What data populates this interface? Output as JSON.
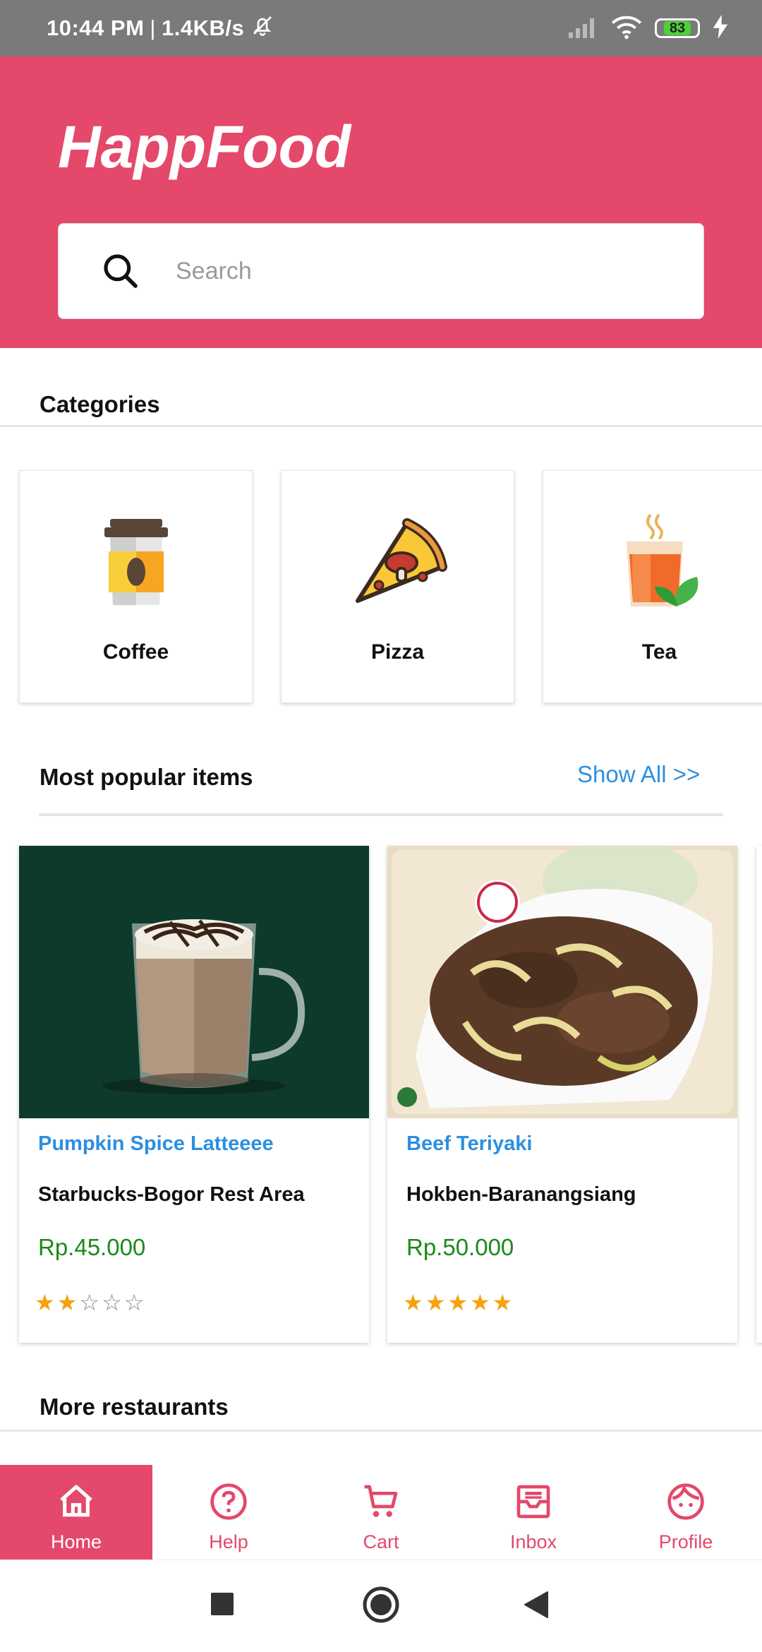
{
  "status_bar": {
    "time": "10:44 PM",
    "separator": "|",
    "speed": "1.4KB/s",
    "battery": "83"
  },
  "header": {
    "app_title": "HappFood",
    "search_placeholder": "Search",
    "background_color": "#e4486a"
  },
  "categories": {
    "title": "Categories",
    "items": [
      {
        "label": "Coffee",
        "icon": "coffee-cup-icon"
      },
      {
        "label": "Pizza",
        "icon": "pizza-slice-icon"
      },
      {
        "label": "Tea",
        "icon": "tea-cup-icon"
      }
    ]
  },
  "popular": {
    "title": "Most popular items",
    "show_all": "Show All >>",
    "items": [
      {
        "name": "Pumpkin Spice Latteeee",
        "restaurant": "Starbucks-Bogor Rest Area",
        "price": "Rp.45.000",
        "rating": 2,
        "max_rating": 5
      },
      {
        "name": "Beef Teriyaki",
        "restaurant": "Hokben-Baranangsiang",
        "price": "Rp.50.000",
        "rating": 5,
        "max_rating": 5
      }
    ]
  },
  "more_restaurants": {
    "title": "More restaurants"
  },
  "bottom_nav": {
    "items": [
      {
        "label": "Home",
        "icon": "home-icon",
        "active": true
      },
      {
        "label": "Help",
        "icon": "help-icon",
        "active": false
      },
      {
        "label": "Cart",
        "icon": "cart-icon",
        "active": false
      },
      {
        "label": "Inbox",
        "icon": "inbox-icon",
        "active": false
      },
      {
        "label": "Profile",
        "icon": "profile-icon",
        "active": false
      }
    ]
  },
  "colors": {
    "accent": "#e4486a",
    "link": "#2d8fe0",
    "price": "#1a8a1a",
    "star": "#f5a20c"
  }
}
